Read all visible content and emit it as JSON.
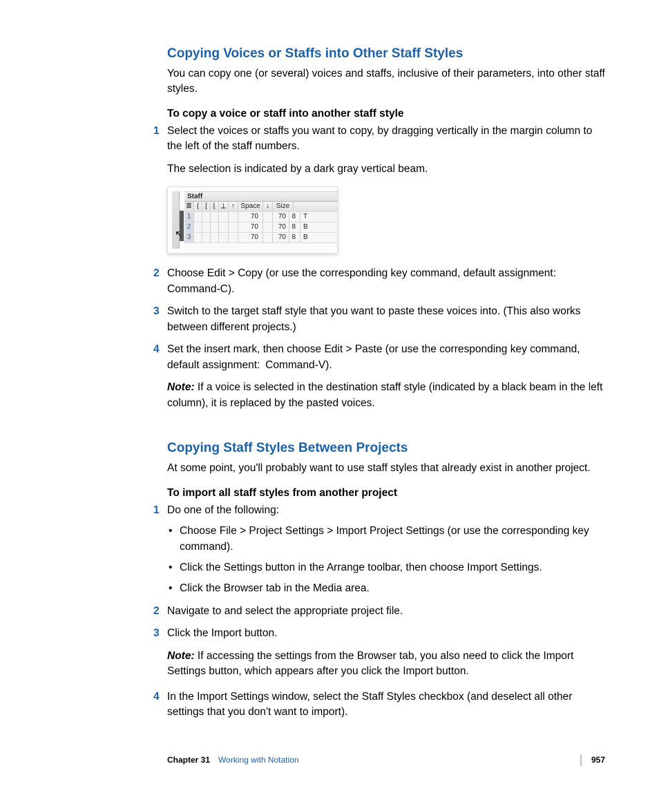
{
  "section1": {
    "heading": "Copying Voices or Staffs into Other Staff Styles",
    "intro": "You can copy one (or several) voices and staffs, inclusive of their parameters, into other staff styles.",
    "proc_label": "To copy a voice or staff into another staff style",
    "steps": {
      "s1": "Select the voices or staffs you want to copy, by dragging vertically in the margin column to the left of the staff numbers.",
      "s1b": "The selection is indicated by a dark gray vertical beam.",
      "s2": "Choose Edit > Copy (or use the corresponding key command, default assignment: Command-C).",
      "s3": "Switch to the target staff style that you want to paste these voices into. (This also works between different projects.)",
      "s4": "Set the insert mark, then choose Edit > Paste (or use the corresponding key command, default assignment: Command-V).",
      "note_label": "Note:",
      "note": " If a voice is selected in the destination staff style (indicated by a black beam in the left column), it is replaced by the pasted voices."
    }
  },
  "figure": {
    "tab": "Staff",
    "hdr": {
      "space": "Space",
      "size": "Size"
    },
    "rows": [
      {
        "n": "1",
        "sp1": "70",
        "sp2": "70",
        "size": "8",
        "last": "T"
      },
      {
        "n": "2",
        "sp1": "70",
        "sp2": "70",
        "size": "8",
        "last": "B"
      },
      {
        "n": "3",
        "sp1": "70",
        "sp2": "70",
        "size": "8",
        "last": "B"
      }
    ],
    "icons": {
      "menu": "≣",
      "brace": "{",
      "br1": "[",
      "br2": "⌊",
      "br3": "⟂",
      "up": "↑",
      "down": "↓"
    }
  },
  "section2": {
    "heading": "Copying Staff Styles Between Projects",
    "intro": "At some point, you'll probably want to use staff styles that already exist in another project.",
    "proc_label": "To import all staff styles from another project",
    "steps": {
      "s1": "Do one of the following:",
      "b1": "Choose File > Project Settings > Import Project Settings (or use the corresponding key command).",
      "b2": "Click the Settings button in the Arrange toolbar, then choose Import Settings.",
      "b3": "Click the Browser tab in the Media area.",
      "s2": "Navigate to and select the appropriate project file.",
      "s3": "Click the Import button.",
      "note_label": "Note:",
      "note": " If accessing the settings from the Browser tab, you also need to click the Import Settings button, which appears after you click the Import button.",
      "s4": "In the Import Settings window, select the Staff Styles checkbox (and deselect all other settings that you don't want to import)."
    }
  },
  "footer": {
    "chapter_label": "Chapter 31",
    "chapter_title": "Working with Notation",
    "page": "957"
  }
}
